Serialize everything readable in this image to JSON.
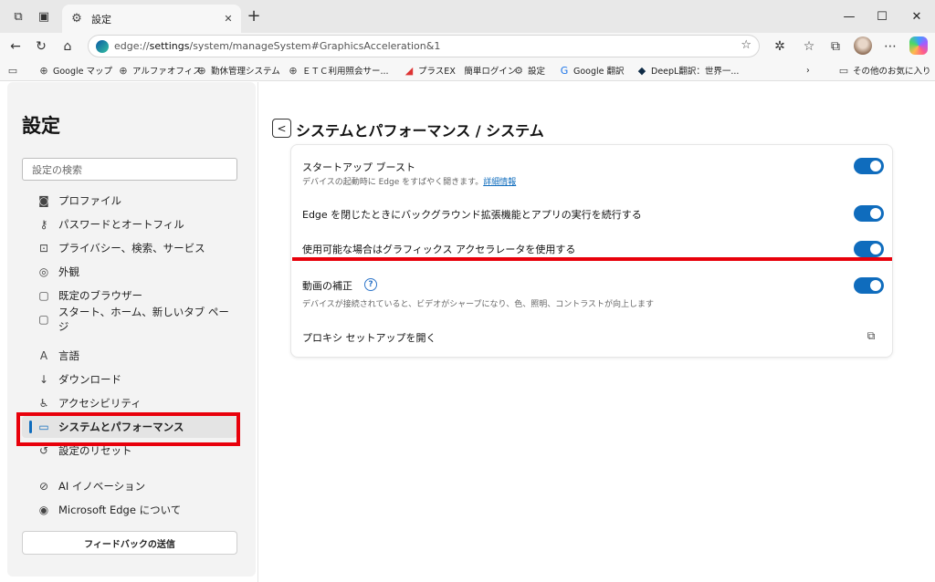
{
  "tab": {
    "title": "設定"
  },
  "address": {
    "prefix": "edge://",
    "bold": "settings",
    "rest": "/system/manageSystem#GraphicsAcceleration&1"
  },
  "favorites": [
    {
      "label": "Google マップ",
      "icon": "globe-icon"
    },
    {
      "label": "アルファオフィス",
      "icon": "globe-icon"
    },
    {
      "label": "勤休管理システム",
      "icon": "globe-icon"
    },
    {
      "label": "ＥＴＣ利用照会サー...",
      "icon": "globe-icon"
    },
    {
      "label": "プラスEX　簡単ログイン",
      "icon": "plus-ex-icon"
    },
    {
      "label": "設定",
      "icon": "gear-icon"
    },
    {
      "label": "Google 翻訳",
      "icon": "translate-icon"
    },
    {
      "label": "DeepL翻訳：世界一...",
      "icon": "deepl-icon"
    }
  ],
  "other_favorites": "その他のお気に入り",
  "sidebar": {
    "title": "設定",
    "search_placeholder": "設定の検索",
    "items": [
      {
        "label": "プロファイル",
        "icon": "profile-icon"
      },
      {
        "label": "パスワードとオートフィル",
        "icon": "key-icon"
      },
      {
        "label": "プライバシー、検索、サービス",
        "icon": "lock-icon"
      },
      {
        "label": "外観",
        "icon": "palette-icon"
      },
      {
        "label": "既定のブラウザー",
        "icon": "browser-icon"
      },
      {
        "label": "スタート、ホーム、新しいタブ ページ",
        "icon": "home-tab-icon"
      },
      {
        "label": "言語",
        "icon": "language-icon"
      },
      {
        "label": "ダウンロード",
        "icon": "download-icon"
      },
      {
        "label": "アクセシビリティ",
        "icon": "accessibility-icon"
      },
      {
        "label": "システムとパフォーマンス",
        "icon": "laptop-icon"
      },
      {
        "label": "設定のリセット",
        "icon": "reset-icon"
      },
      {
        "label": "AI イノベーション",
        "icon": "ai-icon"
      },
      {
        "label": "Microsoft Edge について",
        "icon": "edge-icon"
      }
    ],
    "feedback": "フィードバックの送信"
  },
  "main": {
    "back": "<",
    "title": "システムとパフォーマンス / システム",
    "rows": [
      {
        "title": "スタートアップ ブースト",
        "desc": "デバイスの起動時に Edge をすばやく開きます。",
        "link": "詳細情報",
        "toggle": true
      },
      {
        "title": "Edge を閉じたときにバックグラウンド拡張機能とアプリの実行を続行する",
        "toggle": true
      },
      {
        "title": "使用可能な場合はグラフィックス アクセラレータを使用する",
        "toggle": true
      },
      {
        "title": "動画の補正",
        "desc": "デバイスが接続されていると、ビデオがシャープになり、色、照明、コントラストが向上します",
        "toggle": true
      },
      {
        "title": "プロキシ セットアップを開く"
      }
    ]
  },
  "colors": {
    "accent": "#0f6cbd",
    "highlight": "#e8000b"
  }
}
